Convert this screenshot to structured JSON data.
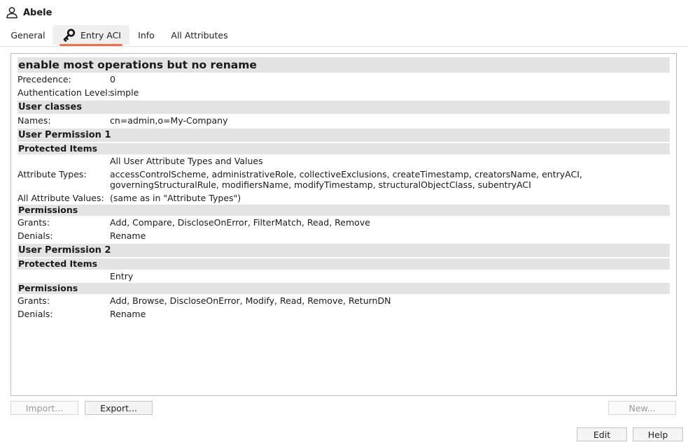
{
  "window": {
    "title": "Abele"
  },
  "tabs": [
    {
      "label": "General"
    },
    {
      "label": "Entry ACI"
    },
    {
      "label": "Info"
    },
    {
      "label": "All Attributes"
    }
  ],
  "aci": {
    "title": "enable most operations but no rename",
    "precedence_label": "Precedence:",
    "precedence_value": "0",
    "auth_label": "Authentication Level:",
    "auth_value": "simple",
    "user_classes": {
      "heading": "User classes",
      "names_label": "Names:",
      "names_value": "cn=admin,o=My-Company"
    },
    "permission1": {
      "heading": "User Permission 1",
      "protected_heading": "Protected Items",
      "all_user_attrs": "All User Attribute Types and Values",
      "attr_types_label": "Attribute Types:",
      "attr_types_value": "accessControlScheme, administrativeRole, collectiveExclusions, createTimestamp, creatorsName, entryACI,\ngoverningStructuralRule, modifiersName, modifyTimestamp, structuralObjectClass, subentryACI",
      "all_attr_values_label": "All Attribute Values:",
      "all_attr_values_value": "(same as in \"Attribute Types\")",
      "permissions_heading": "Permissions",
      "grants_label": "Grants:",
      "grants_value": "Add, Compare, DiscloseOnError, FilterMatch, Read, Remove",
      "denials_label": "Denials:",
      "denials_value": "Rename"
    },
    "permission2": {
      "heading": "User Permission 2",
      "protected_heading": "Protected Items",
      "entry_value": "Entry",
      "permissions_heading": "Permissions",
      "grants_label": "Grants:",
      "grants_value": "Add, Browse, DiscloseOnError, Modify, Read, Remove, ReturnDN",
      "denials_label": "Denials:",
      "denials_value": "Rename"
    }
  },
  "buttons": {
    "import": "Import...",
    "export": "Export...",
    "new": "New...",
    "edit": "Edit",
    "help": "Help"
  },
  "colors": {
    "accent": "#e8704b",
    "section_bg": "#e3e3e3"
  }
}
